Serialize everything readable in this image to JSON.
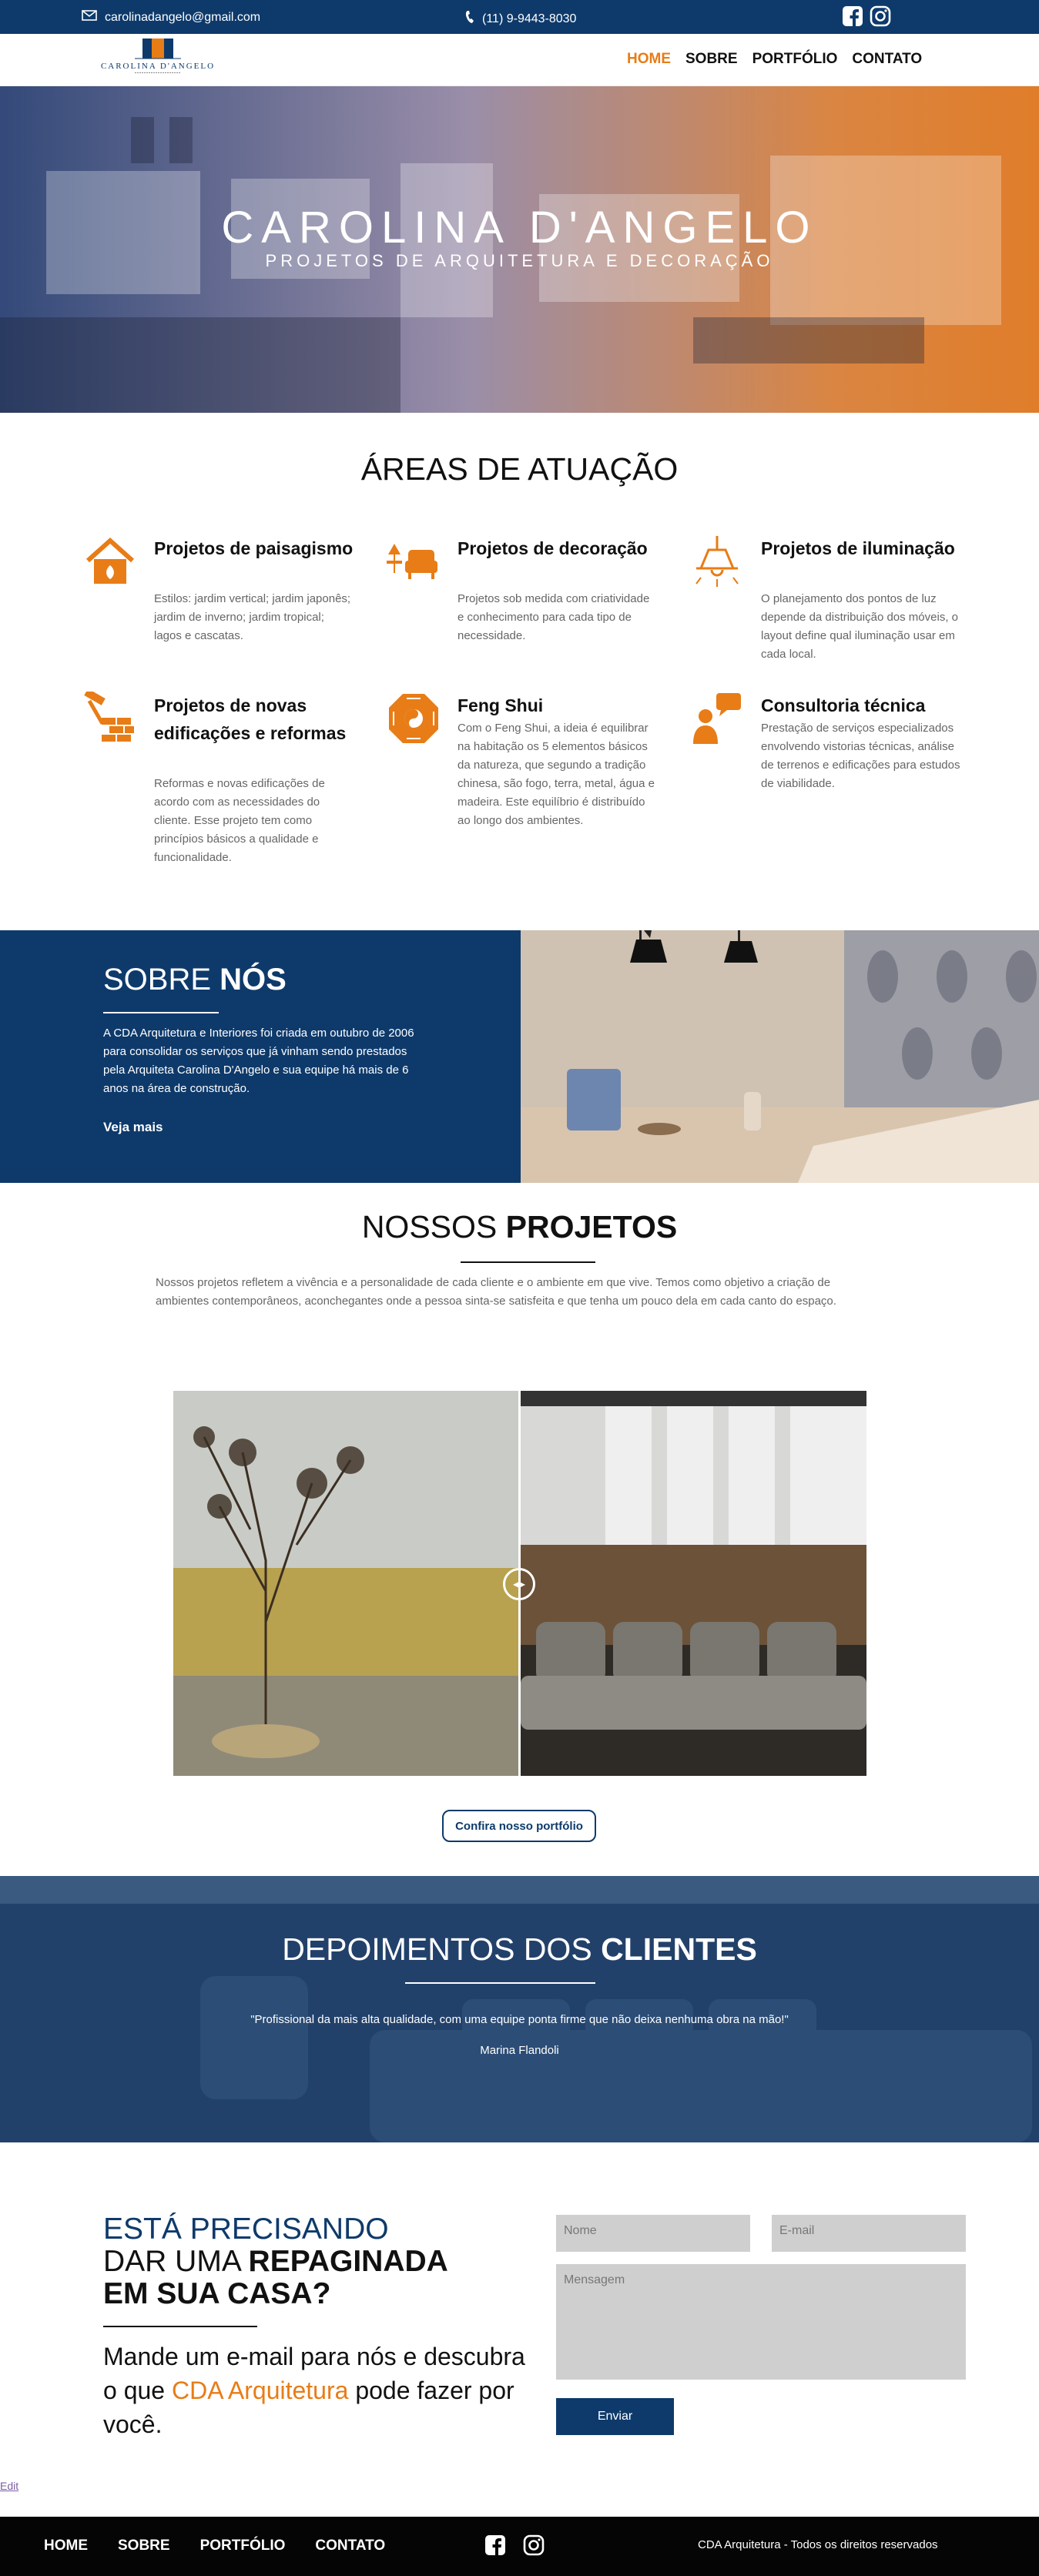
{
  "topbar": {
    "email": "carolinadangelo@gmail.com",
    "phone": "(11) 9-9443-8030",
    "icons": [
      "mail-icon",
      "phone-icon",
      "facebook-icon",
      "instagram-icon"
    ]
  },
  "nav": {
    "logo_brand": "CAROLINA D'ANGELO",
    "items": [
      "HOME",
      "SOBRE",
      "PORTFÓLIO",
      "CONTATO"
    ],
    "active": "HOME"
  },
  "hero": {
    "title": "CAROLINA D'ANGELO",
    "subtitle": "PROJETOS DE ARQUITETURA E DECORAÇÃO"
  },
  "areas": {
    "title": "ÁREAS DE ATUAÇÃO",
    "items": [
      {
        "icon": "house-leaf-icon",
        "title": "Projetos de paisagismo",
        "text": "Estilos: jardim vertical; jardim japonês; jardim de inverno; jardim tropical; lagos e cascatas."
      },
      {
        "icon": "armchair-lamp-icon",
        "title": "Projetos de decoração",
        "text": "Projetos sob medida com criatividade e conhecimento para cada tipo de necessidade."
      },
      {
        "icon": "ceiling-lamp-icon",
        "title": "Projetos de iluminação",
        "text": "O planejamento dos pontos de luz depende da distribuição dos móveis, o layout define qual iluminação usar em cada local."
      },
      {
        "icon": "hammer-bricks-icon",
        "title": "Projetos de novas edificações e reformas",
        "text": "Reformas e novas edificações de acordo com as necessidades do cliente. Esse projeto tem como princípios básicos a qualidade e funcionalidade."
      },
      {
        "icon": "bagua-icon",
        "title": "Feng Shui",
        "text": "Com o Feng Shui, a ideia é equilibrar na habitação os 5 elementos básicos da natureza, que segundo a tradição chinesa, são fogo, terra, metal, água e madeira. Este equilíbrio é distribuído ao longo dos ambientes."
      },
      {
        "icon": "consultant-chat-icon",
        "title": "Consultoria técnica",
        "text": "Prestação de serviços especializados envolvendo vistorias técnicas, análise de terrenos e edificações para estudos de viabilidade."
      }
    ]
  },
  "sobre": {
    "title_light": "SOBRE ",
    "title_bold": "NÓS",
    "text": "A CDA Arquitetura e Interiores foi criada em outubro de 2006 para consolidar os serviços que já vinham sendo prestados pela Arquiteta Carolina D'Angelo e sua equipe há mais de 6 anos na área de construção.",
    "link": "Veja mais"
  },
  "projetos": {
    "title_light": "NOSSOS ",
    "title_bold": "PROJETOS",
    "text": "Nossos projetos refletem a vivência e a personalidade de cada cliente e o ambiente em que vive. Temos como objetivo a criação de ambientes contemporâneos, aconchegantes onde a pessoa sinta-se satisfeita e que tenha um pouco dela em cada canto do espaço.",
    "button": "Confira nosso portfólio"
  },
  "depoimentos": {
    "title_light": "DEPOIMENTOS DOS ",
    "title_bold": "CLIENTES",
    "quote": "\"Profissional da mais alta qualidade, com uma equipe ponta firme que não deixa nenhuma obra na mão!\"",
    "author": "Marina Flandoli"
  },
  "contato": {
    "line1": "ESTÁ PRECISANDO",
    "line2_light": "DAR UMA ",
    "line2_bold": "REPAGINADA",
    "line3": "EM SUA CASA?",
    "sub_a": "Mande um e-mail para nós e descubra o que ",
    "sub_hl": "CDA Arquitetura",
    "sub_b": " pode fazer por você.",
    "name_placeholder": "Nome",
    "email_placeholder": "E-mail",
    "message_placeholder": "Mensagem",
    "send": "Enviar"
  },
  "edit_link": "Edit",
  "footer": {
    "links": [
      "HOME",
      "SOBRE",
      "PORTFÓLIO",
      "CONTATO"
    ],
    "copyright": "CDA Arquitetura - Todos os direitos reservados"
  },
  "colors": {
    "navy": "#0e3a6b",
    "orange": "#e87c16",
    "footer": "#050505"
  }
}
